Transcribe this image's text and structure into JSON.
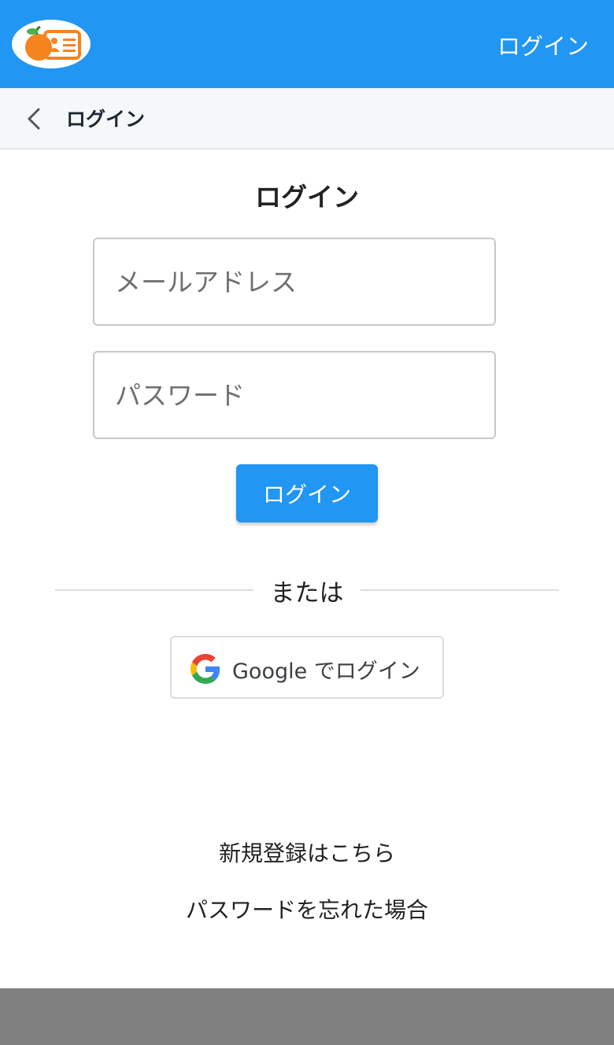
{
  "app_bar": {
    "background": "#2196f3",
    "logo_icon": "orange-id-card-logo",
    "login_link": "ログイン"
  },
  "sub_header": {
    "back_icon": "chevron-left-icon",
    "title": "ログイン"
  },
  "form": {
    "title": "ログイン",
    "email_placeholder": "メールアドレス",
    "email_value": "",
    "password_placeholder": "パスワード",
    "password_value": "",
    "submit_label": "ログイン",
    "divider_text": "または",
    "google_icon": "google-g-icon",
    "google_label": "Google でログイン"
  },
  "links": {
    "register": "新規登録はこちら",
    "forgot_password": "パスワードを忘れた場合"
  },
  "colors": {
    "accent": "#2196f3",
    "logo_orange": "#f5841f",
    "footer": "#808080"
  }
}
